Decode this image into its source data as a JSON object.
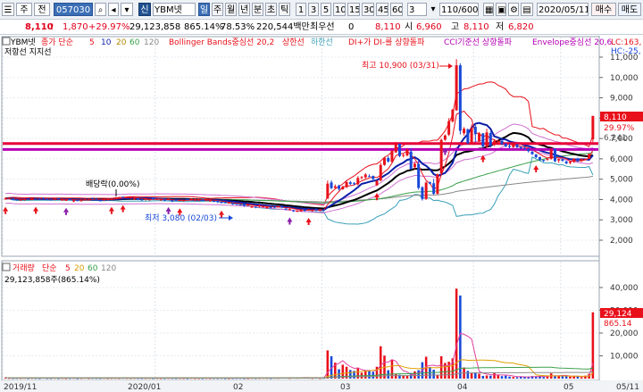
{
  "toolbar": {
    "menu1": "주",
    "menu2": "전",
    "code": "057030",
    "search_icon": "search-icon",
    "sin": "신",
    "name": "YBM넷",
    "periods": [
      "일",
      "주",
      "월",
      "년",
      "분",
      "초",
      "틱"
    ],
    "minutes": [
      "1",
      "3",
      "5",
      "10",
      "15",
      "30",
      "45",
      "60"
    ],
    "minute_select": "3",
    "count": "110/600",
    "date": "2020/05/11",
    "buy": "매수",
    "sell": "매도"
  },
  "quote": {
    "price": "8,110",
    "change": "1,870",
    "rate": "+29.97%",
    "volume": "29,123,858",
    "vol_rate": "865.14%",
    "ratio": "78.53%",
    "amount": "220,544백만",
    "best_label": "최우선",
    "best_value": "0",
    "current": "8,110",
    "open_label": "시",
    "open": "6,960",
    "high_label": "고",
    "high": "8,110",
    "low_label": "저",
    "low": "6,820"
  },
  "legend_main": {
    "name": "YBM넷",
    "ma": "종가 단순",
    "ma_periods": [
      "5",
      "10",
      "20",
      "60",
      "120"
    ],
    "bb": "Bollinger Bands중심선 20,2",
    "bb_up": "상한선",
    "bb_dn": "하한선",
    "dmi": "DI+가 DI-를 상향돌파",
    "cci": "CCI기준선 상향돌파",
    "env": "Envelope중심선 20,6",
    "lc": "LC:163,",
    "hc": "HC:-25,",
    "row2": "저항선  지지선"
  },
  "annotations": {
    "high": "최고 10,900 (03/31)",
    "low": "최저 3,080 (02/03)",
    "dividend": "배당락(0.00%)"
  },
  "price_axis": {
    "ticks": [
      "11,000",
      "10,000",
      "9,000",
      "8,000",
      "7,000",
      "6,000",
      "5,000",
      "4,000",
      "3,000",
      "2,000"
    ],
    "label_price": "8,110",
    "label_rate": "29.97%",
    "label_prev": "6,241"
  },
  "volume": {
    "title": "거래량",
    "ma": "단순",
    "ma_periods": [
      "5",
      "20",
      "60",
      "120"
    ],
    "current": "29,123,858주(865.14%)",
    "ticks": [
      "40,000",
      "30,000",
      "20,000",
      "10,000"
    ],
    "label_current": "29,124",
    "label_rate": "865.14"
  },
  "xaxis": {
    "labels": [
      "2019/11",
      "2020/01",
      "02",
      "03",
      "04",
      "05",
      "05/11"
    ]
  },
  "colors": {
    "up": "#e8101a",
    "down": "#1848d8",
    "ma5": "#e8101a",
    "ma10": "#0b1fa8",
    "ma20": "#000000",
    "ma60": "#3aa04a",
    "ma120": "#888888",
    "resist": "#e8003a",
    "support": "#b400b4"
  },
  "chart_data": {
    "type": "candlestick",
    "y_min": 2000,
    "y_max": 11000,
    "open": [
      4050,
      4050,
      4050,
      4000,
      3990,
      3980,
      4030,
      3990,
      4040,
      4030,
      4060,
      4020,
      4000,
      3990,
      4060,
      3970,
      3980,
      4020,
      3930,
      3970,
      3940,
      4000,
      3980,
      4050,
      4040,
      3970,
      3970,
      4000,
      4030,
      4050,
      4100,
      4130,
      4090,
      4070,
      4020,
      4060,
      4010,
      4000,
      4000,
      4090,
      4020,
      4000,
      3990,
      4000,
      3960,
      3980,
      3980,
      3930,
      4020,
      3990,
      3980,
      3990,
      3990,
      3990,
      3920,
      3930,
      3950,
      3890,
      3880,
      3820,
      3800,
      3800,
      3770,
      3800,
      3710,
      3610,
      3650,
      3670,
      3650,
      3580,
      3630,
      3640,
      3650,
      3650,
      3560,
      3520,
      3460,
      3400,
      3420,
      3490,
      3490,
      3470,
      3540,
      3460,
      3510,
      4050,
      4840,
      4580,
      4690,
      4500,
      4610,
      4850,
      4800,
      4750,
      5070,
      5090,
      5150,
      5160,
      4700,
      4940,
      5700,
      6040,
      5850,
      6320,
      6750,
      6160,
      6170,
      6360,
      5590,
      5750,
      4600,
      4030,
      4850,
      4800,
      4280,
      5290,
      6940,
      7190,
      7840,
      8390,
      10600,
      7260,
      7440,
      6780,
      7580,
      6840,
      7250,
      6590,
      7270,
      6690,
      6800,
      6890,
      6760,
      6630,
      6580,
      6720,
      6600,
      6540,
      6480,
      6350,
      6220,
      6090,
      5950,
      5970,
      6000,
      6500,
      5920,
      5980,
      5870,
      5800,
      5860,
      6000,
      5900,
      6000,
      6000,
      6960
    ],
    "close": [
      4050,
      4080,
      4000,
      3990,
      3990,
      4020,
      4020,
      4060,
      4030,
      4000,
      4030,
      4010,
      3990,
      4050,
      4030,
      4000,
      3980,
      4010,
      3950,
      3960,
      3980,
      4010,
      4000,
      4030,
      4020,
      3950,
      4020,
      4010,
      4030,
      4100,
      4120,
      4110,
      4120,
      4110,
      4060,
      3990,
      3980,
      4050,
      4010,
      4020,
      4030,
      4000,
      3940,
      4040,
      3920,
      3960,
      3980,
      3960,
      3980,
      4040,
      4000,
      3990,
      3970,
      3990,
      3990,
      3910,
      3880,
      3830,
      3830,
      3850,
      3780,
      3790,
      3740,
      3700,
      3750,
      3680,
      3600,
      3710,
      3670,
      3630,
      3590,
      3610,
      3660,
      3630,
      3510,
      3530,
      3450,
      3460,
      3490,
      3460,
      3520,
      3480,
      3470,
      3520,
      3480,
      4780,
      4560,
      4650,
      4520,
      4620,
      4860,
      4770,
      4790,
      5060,
      5100,
      5230,
      5130,
      5010,
      4920,
      5700,
      6060,
      5870,
      6410,
      6720,
      6140,
      6190,
      6450,
      5490,
      5760,
      4570,
      4030,
      4830,
      4780,
      4280,
      5240,
      6930,
      7150,
      7850,
      8420,
      10600,
      7380,
      7480,
      6770,
      7520,
      7210,
      7250,
      6600,
      7300,
      6650,
      6880,
      6800,
      6720,
      6600,
      6580,
      6740,
      6570,
      6530,
      6500,
      6380,
      6230,
      6080,
      5960,
      5940,
      6000,
      6450,
      5880,
      5990,
      5910,
      5780,
      5860,
      6010,
      5880,
      6000,
      6000,
      6240,
      8110
    ],
    "high": [
      4110,
      4120,
      4060,
      4030,
      4030,
      4050,
      4050,
      4110,
      4070,
      4060,
      4100,
      4070,
      4050,
      4080,
      4060,
      4050,
      4040,
      4050,
      3980,
      3980,
      4030,
      4080,
      4040,
      4100,
      4090,
      4010,
      4050,
      4080,
      4090,
      4120,
      4130,
      4160,
      4130,
      4160,
      4080,
      4080,
      4040,
      4070,
      4020,
      4110,
      4060,
      4040,
      4040,
      4060,
      3960,
      4020,
      4010,
      3950,
      4040,
      4060,
      4050,
      4050,
      4020,
      4030,
      4040,
      3950,
      3930,
      3910,
      3880,
      3860,
      3840,
      3800,
      3780,
      3810,
      3810,
      3690,
      3650,
      3760,
      3690,
      3650,
      3660,
      3680,
      3710,
      3680,
      3560,
      3560,
      3500,
      3450,
      3520,
      3520,
      3530,
      3510,
      3570,
      3520,
      3510,
      4930,
      4940,
      4740,
      4730,
      4680,
      4920,
      4920,
      4860,
      5150,
      5160,
      5300,
      5240,
      5180,
      4940,
      5810,
      6100,
      6130,
      6420,
      6830,
      6670,
      6240,
      6500,
      6520,
      5830,
      5940,
      4660,
      4890,
      4880,
      5020,
      5280,
      7000,
      7200,
      8000,
      8450,
      10900,
      10700,
      7560,
      7500,
      7700,
      7660,
      7320,
      7270,
      7480,
      7360,
      6970,
      6950,
      6930,
      6760,
      6750,
      6800,
      6720,
      6610,
      6580,
      6530,
      6390,
      6230,
      6100,
      5960,
      6060,
      6520,
      6500,
      6010,
      6030,
      5910,
      5880,
      6020,
      6060,
      5930,
      6020,
      6260,
      8110
    ],
    "low": [
      3990,
      4010,
      3970,
      3950,
      3950,
      3940,
      4000,
      3970,
      4000,
      4000,
      4000,
      3970,
      3960,
      3960,
      4010,
      3930,
      3940,
      3970,
      3870,
      3920,
      3890,
      3950,
      3950,
      4020,
      3990,
      3900,
      3930,
      3980,
      3990,
      4030,
      4060,
      4080,
      4060,
      4040,
      3990,
      3970,
      3930,
      3950,
      3950,
      3980,
      3970,
      3940,
      3930,
      3980,
      3870,
      3930,
      3920,
      3920,
      3970,
      3960,
      3920,
      3960,
      3950,
      3920,
      3880,
      3870,
      3820,
      3810,
      3800,
      3800,
      3740,
      3720,
      3710,
      3640,
      3680,
      3580,
      3570,
      3610,
      3600,
      3540,
      3560,
      3570,
      3630,
      3570,
      3480,
      3470,
      3390,
      3380,
      3400,
      3400,
      3450,
      3410,
      3420,
      3420,
      3450,
      4030,
      4510,
      4540,
      4440,
      4480,
      4560,
      4720,
      4710,
      4690,
      4990,
      5030,
      5110,
      4910,
      4670,
      4900,
      5660,
      5820,
      5780,
      6290,
      6080,
      6070,
      6120,
      5460,
      5500,
      4480,
      3950,
      3980,
      4750,
      4230,
      4250,
      5220,
      6890,
      7120,
      7780,
      8360,
      7200,
      7150,
      6700,
      6700,
      6830,
      7190,
      6540,
      6540,
      6560,
      6630,
      6720,
      6670,
      6590,
      6520,
      6530,
      6530,
      6480,
      6430,
      6310,
      6190,
      6040,
      5890,
      5840,
      5910,
      5960,
      5840,
      5810,
      5850,
      5730,
      5730,
      5800,
      5840,
      5840,
      5980,
      6000,
      6820
    ],
    "volume_k": [
      420,
      310,
      260,
      290,
      280,
      350,
      240,
      300,
      270,
      230,
      380,
      260,
      250,
      330,
      240,
      310,
      230,
      270,
      340,
      210,
      290,
      360,
      260,
      300,
      270,
      240,
      330,
      250,
      280,
      310,
      260,
      340,
      300,
      280,
      320,
      270,
      260,
      290,
      310,
      230,
      280,
      250,
      240,
      300,
      270,
      230,
      280,
      260,
      210,
      320,
      250,
      260,
      220,
      290,
      240,
      270,
      250,
      300,
      230,
      220,
      260,
      280,
      300,
      230,
      240,
      320,
      270,
      300,
      350,
      310,
      250,
      360,
      320,
      420,
      380,
      300,
      410,
      350,
      520,
      480,
      380,
      300,
      410,
      260,
      340,
      12400,
      9800,
      7000,
      4100,
      6100,
      5200,
      3800,
      3400,
      4800,
      2600,
      3700,
      3300,
      3000,
      5200,
      14200,
      10100,
      3700,
      8400,
      2100,
      1700,
      1200,
      1300,
      2500,
      3200,
      3700,
      7200,
      9600,
      5100,
      3900,
      1600,
      9800,
      6900,
      7400,
      8900,
      39500,
      36500,
      4900,
      3400,
      2600,
      2700,
      2100,
      1200,
      1400,
      1300,
      2500,
      1700,
      1100,
      1300,
      900,
      700,
      600,
      800,
      900,
      700,
      1100,
      1000,
      1200,
      700,
      900,
      2300,
      1300,
      1100,
      1400,
      1000,
      900,
      1100,
      900,
      600,
      1300,
      2100,
      29124
    ],
    "resistance": 6750,
    "support": 6460,
    "high_point": {
      "date": "03/31",
      "value": 10900
    },
    "low_point": {
      "date": "02/03",
      "value": 3080
    }
  }
}
